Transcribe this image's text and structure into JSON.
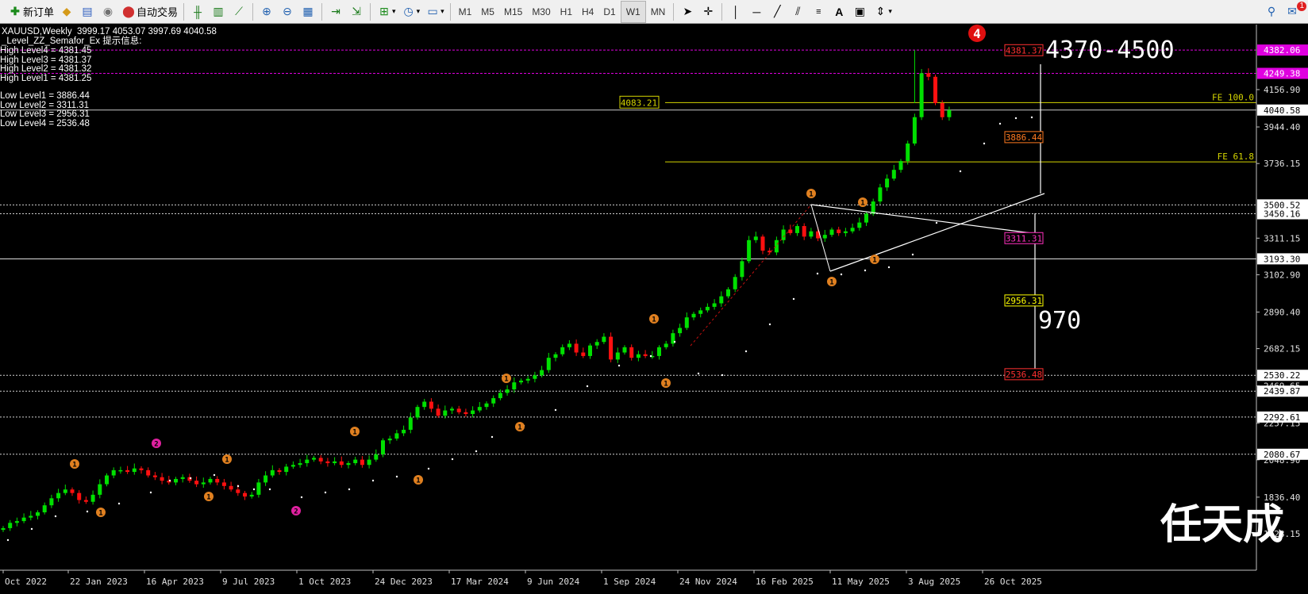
{
  "toolbar": {
    "new_order": "新订单",
    "auto_trade": "自动交易",
    "timeframes": [
      "M1",
      "M5",
      "M15",
      "M30",
      "H1",
      "H4",
      "D1",
      "W1",
      "MN"
    ],
    "notification_count": "1"
  },
  "chart_info": {
    "symbol_line": "XAUUSD,Weekly  3999.17 4053.07 3997.69 4040.58",
    "indicator_line": "_Level_ZZ_Semafor_Ex 提示信息:",
    "levels": [
      "High Level4 = 4381.45",
      "High Level3 = 4381.37",
      "High Level2 = 4381.32",
      "High Level1 = 4381.25",
      "",
      "Low Level1 = 3886.44",
      "Low Level2 = 3311.31",
      "Low Level3 = 2956.31",
      "Low Level4 = 2536.48"
    ]
  },
  "price_axis": {
    "ticks": [
      "4156.90",
      "3944.40",
      "3736.15",
      "3311.15",
      "3102.90",
      "2890.40",
      "2682.15",
      "2469.65",
      "2257.15",
      "2048.90",
      "1836.40",
      "1628.15"
    ],
    "highlight_labels": [
      {
        "text": "4382.06",
        "bg": "#e000e0",
        "fg": "#ffffff",
        "price": 4382.06
      },
      {
        "text": "4249.38",
        "bg": "#e000e0",
        "fg": "#ffffff",
        "price": 4249.38
      },
      {
        "text": "4040.58",
        "bg": "#ffffff",
        "fg": "#000000",
        "price": 4040.58
      },
      {
        "text": "3500.52",
        "bg": "#ffffff",
        "fg": "#000000",
        "price": 3500.52
      },
      {
        "text": "3450.16",
        "bg": "#ffffff",
        "fg": "#000000",
        "price": 3450.16
      },
      {
        "text": "3193.30",
        "bg": "#ffffff",
        "fg": "#000000",
        "price": 3193.3
      },
      {
        "text": "2530.22",
        "bg": "#ffffff",
        "fg": "#000000",
        "price": 2530.22
      },
      {
        "text": "2439.87",
        "bg": "#ffffff",
        "fg": "#000000",
        "price": 2439.87
      },
      {
        "text": "2292.61",
        "bg": "#ffffff",
        "fg": "#000000",
        "price": 2292.61
      },
      {
        "text": "2080.67",
        "bg": "#ffffff",
        "fg": "#000000",
        "price": 2080.67
      }
    ]
  },
  "time_axis": [
    "Oct 2022",
    "22 Jan 2023",
    "16 Apr 2023",
    "9 Jul 2023",
    "1 Oct 2023",
    "24 Dec 2023",
    "17 Mar 2024",
    "9 Jun 2024",
    "1 Sep 2024",
    "24 Nov 2024",
    "16 Feb 2025",
    "11 May 2025",
    "3 Aug 2025",
    "26 Oct 2025"
  ],
  "level_boxes": [
    {
      "text": "4381.37",
      "color": "#ff3030",
      "price": 4381.37
    },
    {
      "text": "3886.44",
      "color": "#ff7a20",
      "price": 3886.44
    },
    {
      "text": "3311.31",
      "color": "#ff30c0",
      "price": 3311.31
    },
    {
      "text": "2956.31",
      "color": "#ffff00",
      "price": 2956.31
    },
    {
      "text": "2536.48",
      "color": "#ff3030",
      "price": 2536.48
    }
  ],
  "fib": {
    "box_label": "4083.21",
    "fe100": "FE 100.0",
    "fe618": "FE 61.8"
  },
  "annotations": {
    "target": "4370-4500",
    "range": "970",
    "watermark": "任天成",
    "peak_marker": "4"
  },
  "colors": {
    "bull": "#00e000",
    "bear": "#ff1010",
    "fib": "#d4d400",
    "magenta_line": "#e000e0"
  }
}
